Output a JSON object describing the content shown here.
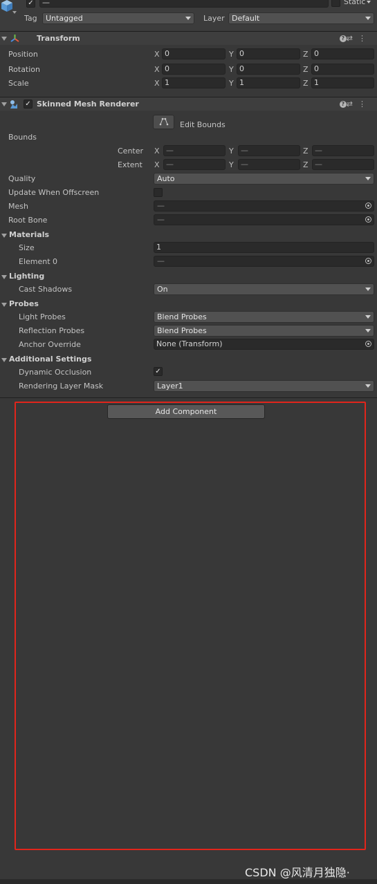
{
  "top": {
    "name_value": "—",
    "static_label": "Static",
    "tag_label": "Tag",
    "tag_value": "Untagged",
    "layer_label": "Layer",
    "layer_value": "Default"
  },
  "transform": {
    "title": "Transform",
    "rows": [
      {
        "label": "Position",
        "x": "0",
        "y": "0",
        "z": "0"
      },
      {
        "label": "Rotation",
        "x": "0",
        "y": "0",
        "z": "0"
      },
      {
        "label": "Scale",
        "x": "1",
        "y": "1",
        "z": "1"
      }
    ]
  },
  "axes": {
    "x": "X",
    "y": "Y",
    "z": "Z"
  },
  "renderer": {
    "title": "Skinned Mesh Renderer",
    "edit_bounds": "Edit Bounds",
    "bounds_label": "Bounds",
    "center_label": "Center",
    "extent_label": "Extent",
    "dash": "—",
    "quality_label": "Quality",
    "quality_value": "Auto",
    "update_offscreen_label": "Update When Offscreen",
    "mesh_label": "Mesh",
    "mesh_value": "—",
    "root_bone_label": "Root Bone",
    "root_bone_value": "—",
    "materials_label": "Materials",
    "size_label": "Size",
    "size_value": "1",
    "element0_label": "Element 0",
    "element0_value": "—",
    "lighting_label": "Lighting",
    "cast_shadows_label": "Cast Shadows",
    "cast_shadows_value": "On",
    "probes_label": "Probes",
    "light_probes_label": "Light Probes",
    "light_probes_value": "Blend Probes",
    "reflection_probes_label": "Reflection Probes",
    "reflection_probes_value": "Blend Probes",
    "anchor_override_label": "Anchor Override",
    "anchor_override_value": "None (Transform)",
    "additional_label": "Additional Settings",
    "dynamic_occlusion_label": "Dynamic Occlusion",
    "rendering_layer_label": "Rendering Layer Mask",
    "rendering_layer_value": "Layer1"
  },
  "add_component": "Add Component",
  "watermark": "CSDN @风清月独隐·",
  "colors": {
    "highlight": "#e1251b",
    "background": "#383838"
  }
}
